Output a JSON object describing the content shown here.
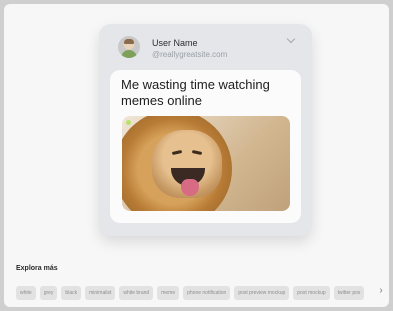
{
  "post": {
    "username": "User Name",
    "handle": "@reallygreatsite.com",
    "message": "Me wasting time watching memes online"
  },
  "explore": {
    "title": "Explora más",
    "tags": [
      "white",
      "grey",
      "black",
      "minimalist",
      "white brand",
      "meme",
      "phone notification",
      "post preview mockup",
      "post mockup",
      "twitter pos"
    ],
    "next_icon": "chevron-right-icon"
  },
  "colors": {
    "page_bg": "#f7f7f7",
    "card_bg": "#e4e6ea",
    "content_bg": "#fbfbfb",
    "tag_bg": "#e2e2e2",
    "accent_dot": "#b7e36a"
  }
}
